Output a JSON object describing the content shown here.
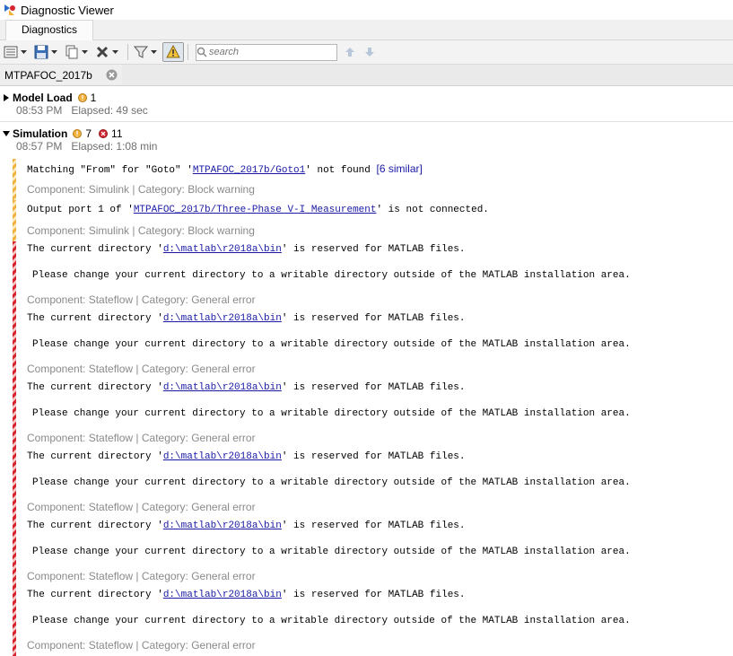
{
  "window": {
    "title": "Diagnostic Viewer",
    "icon": "diagnostic-viewer-icon"
  },
  "tabs": [
    {
      "label": "Diagnostics"
    }
  ],
  "toolbar": {
    "buttons": [
      "view-icon",
      "save-icon",
      "copy-icon",
      "delete-icon",
      "filter-icon",
      "warning-toggle-icon"
    ],
    "search_placeholder": "search",
    "nav": [
      "up-arrow-icon",
      "down-arrow-icon"
    ]
  },
  "model_tab": {
    "label": "MTPAFOC_2017b"
  },
  "sections": {
    "model_load": {
      "name": "Model Load",
      "warnings": "1",
      "time": "08:53 PM",
      "elapsed": "Elapsed: 49 sec"
    },
    "simulation": {
      "name": "Simulation",
      "warnings": "7",
      "errors": "11",
      "time": "08:57 PM",
      "elapsed": "Elapsed: 1:08 min"
    }
  },
  "messages": {
    "w1": {
      "pre": "Matching \"From\" for \"Goto\" '",
      "link": "MTPAFOC_2017b/Goto1",
      "post": "' not found ",
      "extra": "[6 similar]",
      "component": "Component: Simulink | Category: Block warning"
    },
    "w2": {
      "pre": "Output port 1 of '",
      "link": "MTPAFOC_2017b/Three-Phase V-I Measurement",
      "post": "' is not connected.",
      "component": "Component: Simulink | Category: Block warning"
    },
    "err": {
      "pre": "The current directory '",
      "link": "d:\\matlab\\r2018a\\bin",
      "post": "' is reserved for MATLAB files.",
      "line2": "Please change your current directory to a writable directory outside of the MATLAB installation area.",
      "component": "Component: Stateflow | Category: General error"
    }
  },
  "colors": {
    "warning": "#f3b13d",
    "error": "#d7242f",
    "link": "#1a1aa6"
  }
}
